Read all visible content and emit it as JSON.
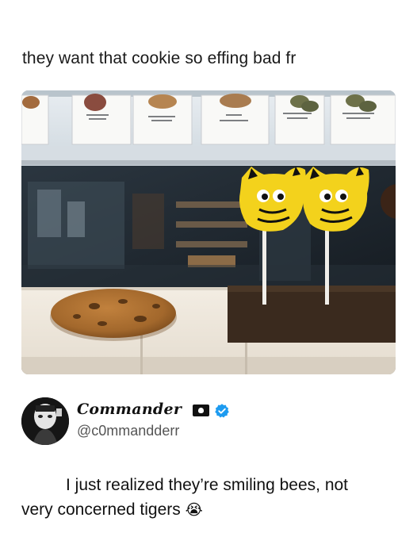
{
  "post": {
    "caption": "they want that cookie so effing bad fr"
  },
  "tweet": {
    "display_name": "Commander",
    "handle": "@c0mmandderr",
    "text_line1": "I just realized they’re smiling bees, not",
    "text_line2": "very concerned tigers",
    "emoji": "😭"
  },
  "icons": {
    "flag": "pirate-flag-icon",
    "verified": "verified-badge-icon",
    "emoji": "loudly-crying-face-icon"
  },
  "colors": {
    "verified_blue": "#1d9bf0",
    "cake_pop_yellow": "#f3d21c",
    "cookie_brown": "#a3682c"
  }
}
